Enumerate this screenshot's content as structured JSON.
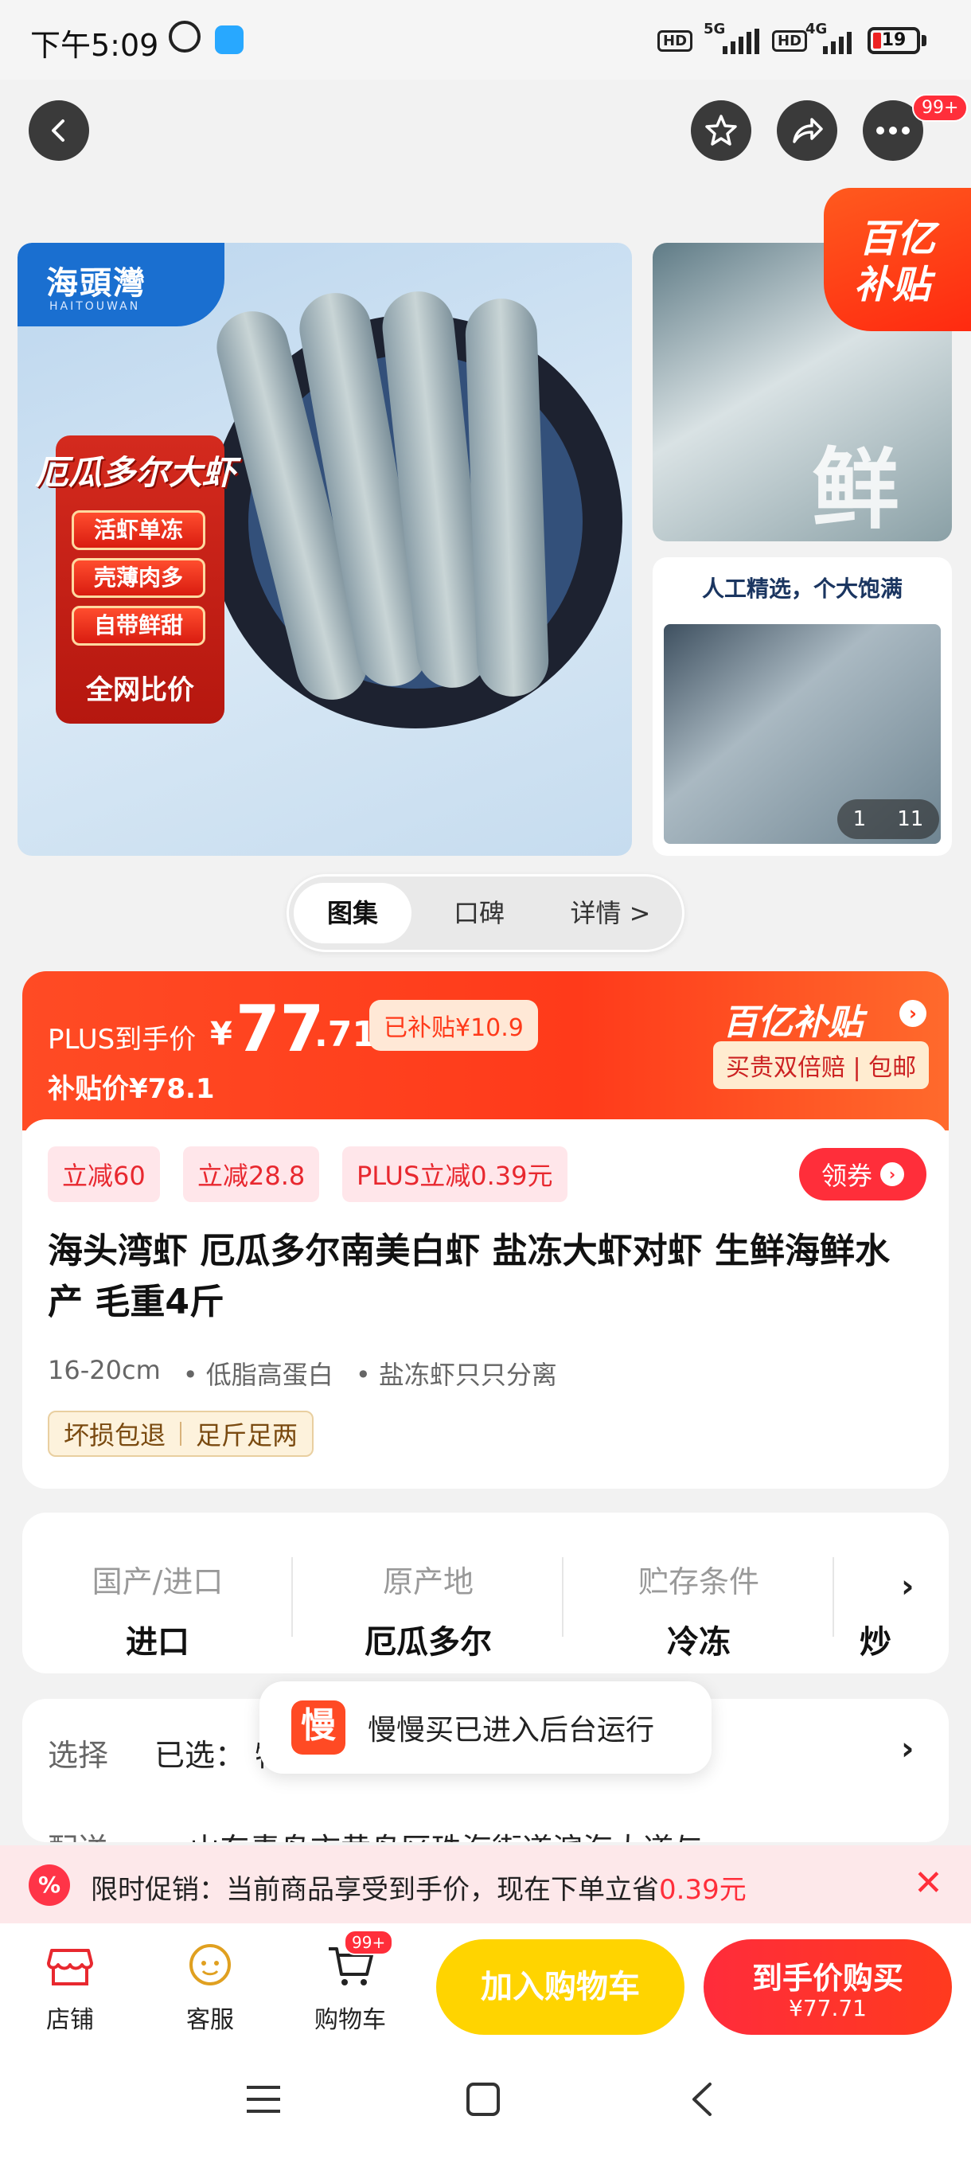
{
  "status_bar": {
    "time": "下午5:09",
    "hd1": "HD",
    "net1": "5G",
    "hd2": "HD",
    "net2": "4G",
    "battery": "19"
  },
  "top_nav": {
    "more_badge": "99+"
  },
  "gallery": {
    "brand": "海頭灣",
    "brand_sub": "HAITOUWAN",
    "promo_title": "厄瓜多尔大虾",
    "promo_pills": [
      "活虾单冻",
      "壳薄肉多",
      "自带鲜甜"
    ],
    "promo_foot": "全网比价",
    "side_caption": "人工精选，个大饱满",
    "side_big_char": "鲜",
    "counter_current": "1",
    "counter_total": "11",
    "subsidy_line1": "百亿",
    "subsidy_line2": "补贴"
  },
  "tabs": [
    {
      "label": "图集",
      "active": true
    },
    {
      "label": "口碑",
      "active": false
    },
    {
      "label": "详情 >",
      "active": false
    }
  ],
  "price": {
    "plus_label": "PLUS到手价",
    "currency": "¥",
    "integer": "77",
    "decimal": ".71",
    "subsidized": "已补贴¥10.9",
    "subsidy_price": "补贴价¥78.1",
    "program": "百亿补贴",
    "program_arrow": "›",
    "program_sub": "买贵双倍赔 | 包邮"
  },
  "coupons": [
    "立减60",
    "立减28.8",
    "PLUS立减0.39元"
  ],
  "coupon_button": "领券",
  "product": {
    "title": "海头湾虾 厄瓜多尔南美白虾 盐冻大虾对虾 生鲜海鲜水产  毛重4斤",
    "attributes": [
      "16-20cm",
      "• 低脂高蛋白",
      "• 盐冻虾只只分离"
    ],
    "service_1": "坏损包退",
    "service_2": "足斤足两"
  },
  "specs": [
    {
      "key": "国产/进口",
      "value": "进口"
    },
    {
      "key": "原产地",
      "value": "厄瓜多尔"
    },
    {
      "key": "贮存条件",
      "value": "冷冻"
    },
    {
      "key": "",
      "value": "炒"
    }
  ],
  "selection": {
    "label": "选择",
    "value": "已选：  特级26/30规格16-21cm，1件",
    "delivery_label": "配送",
    "delivery_value": "山东青岛市黄岛区珠海街道滨海大道与......"
  },
  "toast": {
    "icon_text": "慢",
    "text": "慢慢买已进入后台运行"
  },
  "promo_strip": {
    "icon": "%",
    "text_prefix": "限时促销：当前商品享受到手价，现在下单立省",
    "amount": "0.39元",
    "close": "✕"
  },
  "bottom_bar": {
    "shop": "店铺",
    "service": "客服",
    "cart": "购物车",
    "cart_badge": "99+",
    "add_to_cart": "加入购物车",
    "buy_line1": "到手价购买",
    "buy_line2": "¥77.71"
  }
}
